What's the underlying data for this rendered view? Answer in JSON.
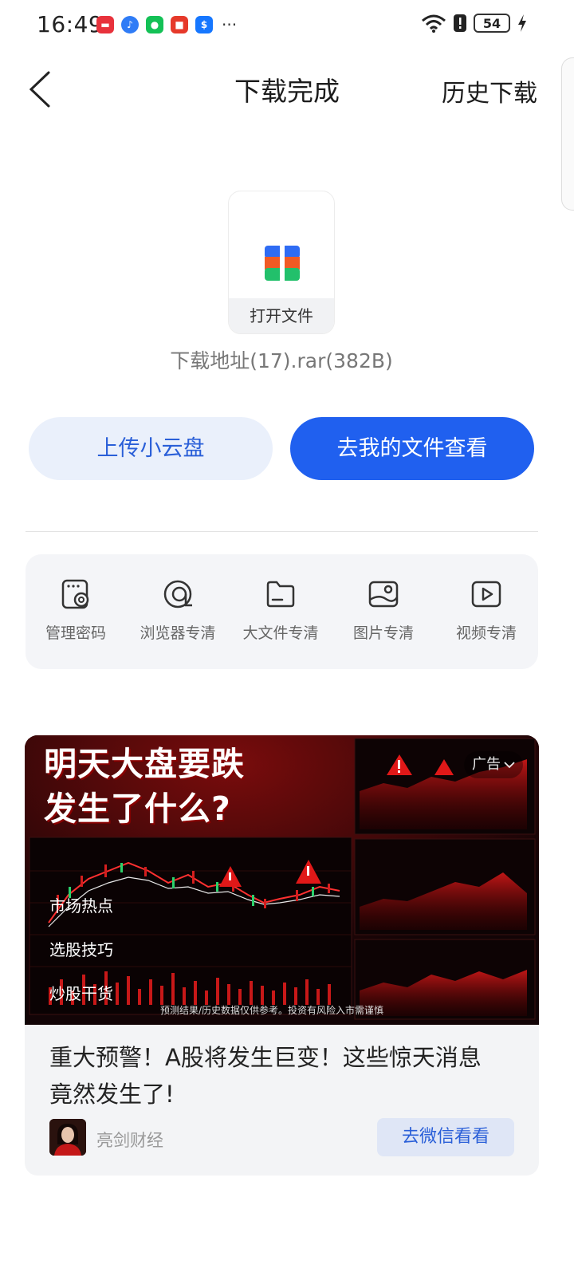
{
  "status_bar": {
    "time": "16:49",
    "battery": "54",
    "notification_icons": [
      "news-app-icon",
      "music-app-icon",
      "wechat-icon",
      "shopping-app-icon",
      "alipay-icon"
    ]
  },
  "header": {
    "title": "下载完成",
    "history_label": "历史下载"
  },
  "file": {
    "open_label": "打开文件",
    "name": "下载地址(17).rar(382B)"
  },
  "actions": {
    "upload_label": "上传小云盘",
    "view_label": "去我的文件查看"
  },
  "tools": [
    {
      "label": "管理密码",
      "icon": "password-manager-icon"
    },
    {
      "label": "浏览器专清",
      "icon": "browser-clean-icon"
    },
    {
      "label": "大文件专清",
      "icon": "large-file-clean-icon"
    },
    {
      "label": "图片专清",
      "icon": "image-clean-icon"
    },
    {
      "label": "视频专清",
      "icon": "video-clean-icon"
    }
  ],
  "ad": {
    "headline_line1": "明天大盘要跌",
    "headline_line2": "发生了什么?",
    "badge": "广告",
    "tags": [
      "市场热点",
      "选股技巧",
      "炒股干货"
    ],
    "disclaimer": "预测结果/历史数据仅供参考。投资有风险入市需谨慎",
    "title": "重大预警！A股将发生巨变！这些惊天消息竟然发生了!",
    "source": "亮剑财经",
    "cta": "去微信看看"
  },
  "colors": {
    "primary": "#2060ef",
    "primary_light": "#eaf0fb",
    "ad_red": "#d01818"
  }
}
